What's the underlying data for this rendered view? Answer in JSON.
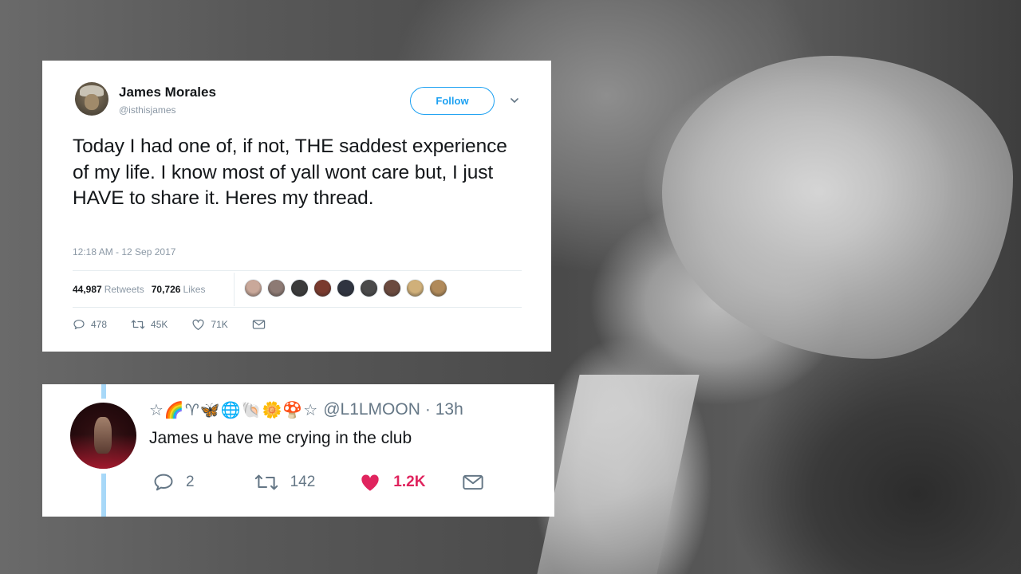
{
  "tweet": {
    "author_name": "James Morales",
    "author_handle": "@isthisjames",
    "follow_label": "Follow",
    "text": "Today I had one of, if not, THE saddest experience of my life. I know most of yall wont care but, I just HAVE to share it. Heres my thread.",
    "timestamp": "12:18 AM - 12 Sep 2017",
    "retweets_count": "44,987",
    "retweets_label": "Retweets",
    "likes_count": "70,726",
    "likes_label": "Likes",
    "liker_avatars": [
      "#c9a89a",
      "#8d7a74",
      "#3b3b3b",
      "#7a3a2e",
      "#2f3440",
      "#4a4a4a",
      "#6b4a3e",
      "#d0b07a",
      "#b08a5a"
    ],
    "actions": {
      "reply_count": "478",
      "retweet_count": "45K",
      "like_count": "71K"
    },
    "icons": [
      "chevron-down-icon",
      "reply-icon",
      "retweet-icon",
      "heart-icon",
      "mail-icon"
    ]
  },
  "reply": {
    "name_emojis": "☆🌈♈🦋🌐🐚🌼🍄☆",
    "handle": "@L1LMOON",
    "time": "· 13h",
    "text": "James u have me crying in the club",
    "reply_count": "2",
    "retweet_count": "142",
    "like_count": "1.2K",
    "like_color": "#e0245e",
    "thread_line_color": "#a7d8f8"
  },
  "colors": {
    "twitter_blue": "#1da1f2",
    "text_primary": "#14171a",
    "text_secondary": "#8b98a5"
  }
}
